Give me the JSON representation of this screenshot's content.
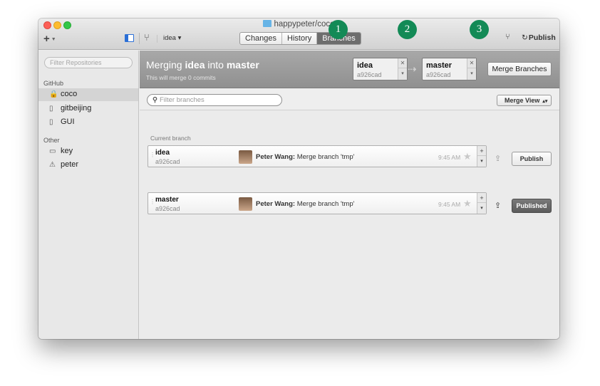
{
  "window": {
    "title": "happypeter/coco"
  },
  "toolbar": {
    "add_label": "+",
    "current_branch": "idea",
    "tabs": [
      {
        "label": "Changes"
      },
      {
        "label": "History"
      },
      {
        "label": "Branches",
        "active": true
      }
    ],
    "publish_label": "Publish"
  },
  "sidebar": {
    "filter_placeholder": "Filter Repositories",
    "sections": [
      {
        "label": "GitHub",
        "repos": [
          {
            "name": "coco",
            "icon": "lock-book-icon",
            "selected": true
          },
          {
            "name": "gitbeijing",
            "icon": "book-icon"
          },
          {
            "name": "GUI",
            "icon": "book-icon"
          }
        ]
      },
      {
        "label": "Other",
        "repos": [
          {
            "name": "key",
            "icon": "computer-icon"
          },
          {
            "name": "peter",
            "icon": "warning-icon"
          }
        ]
      }
    ]
  },
  "merge": {
    "title_prefix": "Merging",
    "source": "idea",
    "title_mid": "into",
    "target": "master",
    "subtitle": "This will merge 0 commits",
    "source_box": {
      "name": "idea",
      "sha": "a926cad"
    },
    "target_box": {
      "name": "master",
      "sha": "a926cad"
    },
    "button_label": "Merge Branches",
    "steps": [
      "1",
      "2",
      "3"
    ]
  },
  "branches": {
    "filter_placeholder": "Filter branches",
    "view_label": "Merge View",
    "current_label": "Current branch",
    "rows": [
      {
        "name": "idea",
        "sha": "a926cad",
        "author": "Peter Wang:",
        "message": "Merge branch 'tmp'",
        "time": "9:45 AM",
        "action": "Publish",
        "published": false
      },
      {
        "name": "master",
        "sha": "a926cad",
        "author": "Peter Wang:",
        "message": "Merge branch 'tmp'",
        "time": "9:45 AM",
        "action": "Published",
        "published": true
      }
    ]
  }
}
